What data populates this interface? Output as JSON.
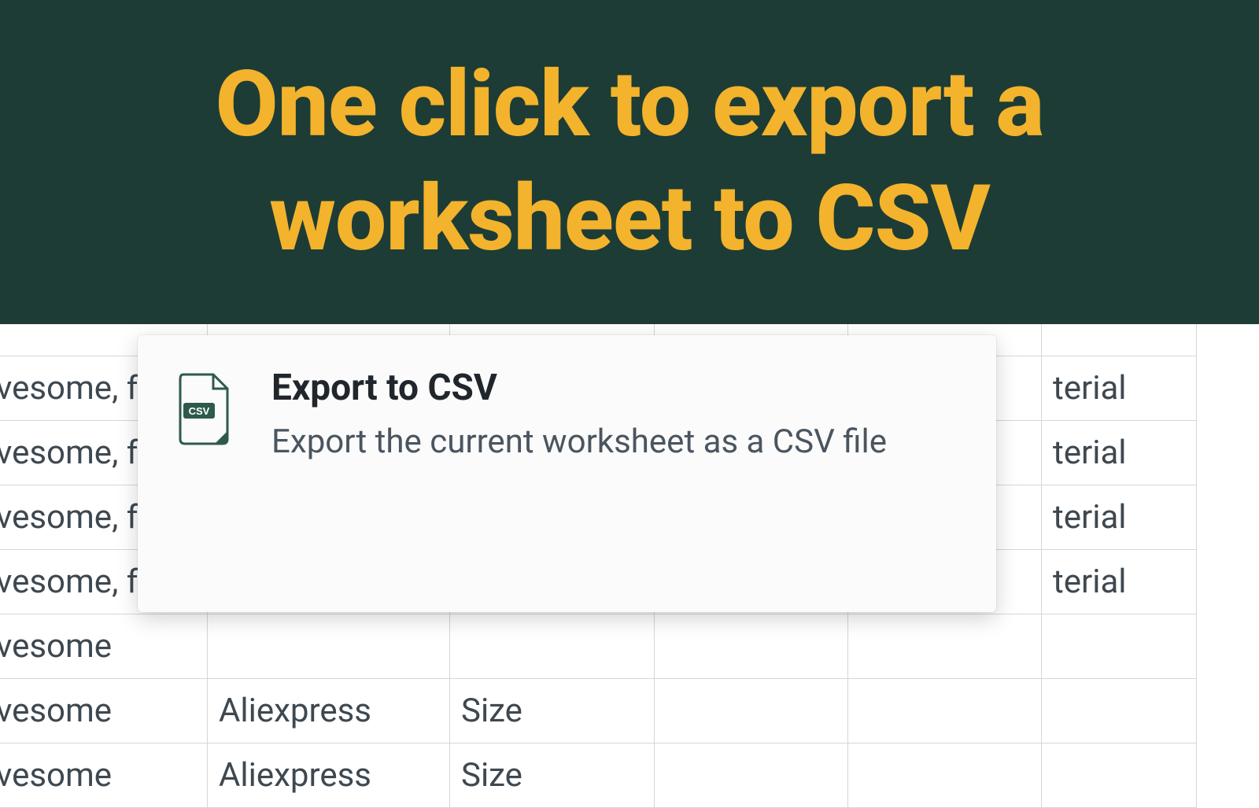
{
  "banner": {
    "headline": "One click to export a worksheet to CSV"
  },
  "popup": {
    "title": "Export to CSV",
    "description": "Export the current worksheet as a CSV file",
    "icon_badge": "CSV"
  },
  "sheet": {
    "rows": [
      {
        "a": "vesome, fı",
        "b": "",
        "c": "",
        "d": "",
        "e": "",
        "f": "terial"
      },
      {
        "a": "vesome, fı",
        "b": "",
        "c": "",
        "d": "",
        "e": "",
        "f": "terial"
      },
      {
        "a": "vesome, fı",
        "b": "",
        "c": "",
        "d": "",
        "e": "",
        "f": "terial"
      },
      {
        "a": "vesome, fı",
        "b": "",
        "c": "",
        "d": "",
        "e": "",
        "f": "terial"
      },
      {
        "a": "vesome",
        "b": "",
        "c": "",
        "d": "",
        "e": "",
        "f": ""
      },
      {
        "a": "vesome",
        "b": "Aliexpress",
        "c": "Size",
        "d": "",
        "e": "",
        "f": ""
      },
      {
        "a": "vesome",
        "b": "Aliexpress",
        "c": "Size",
        "d": "",
        "e": "",
        "f": ""
      }
    ]
  },
  "colors": {
    "banner_bg": "#1d3c36",
    "banner_text": "#f3b32c",
    "grid_border": "#d6d6d6",
    "icon_stroke": "#2e5a4c"
  }
}
